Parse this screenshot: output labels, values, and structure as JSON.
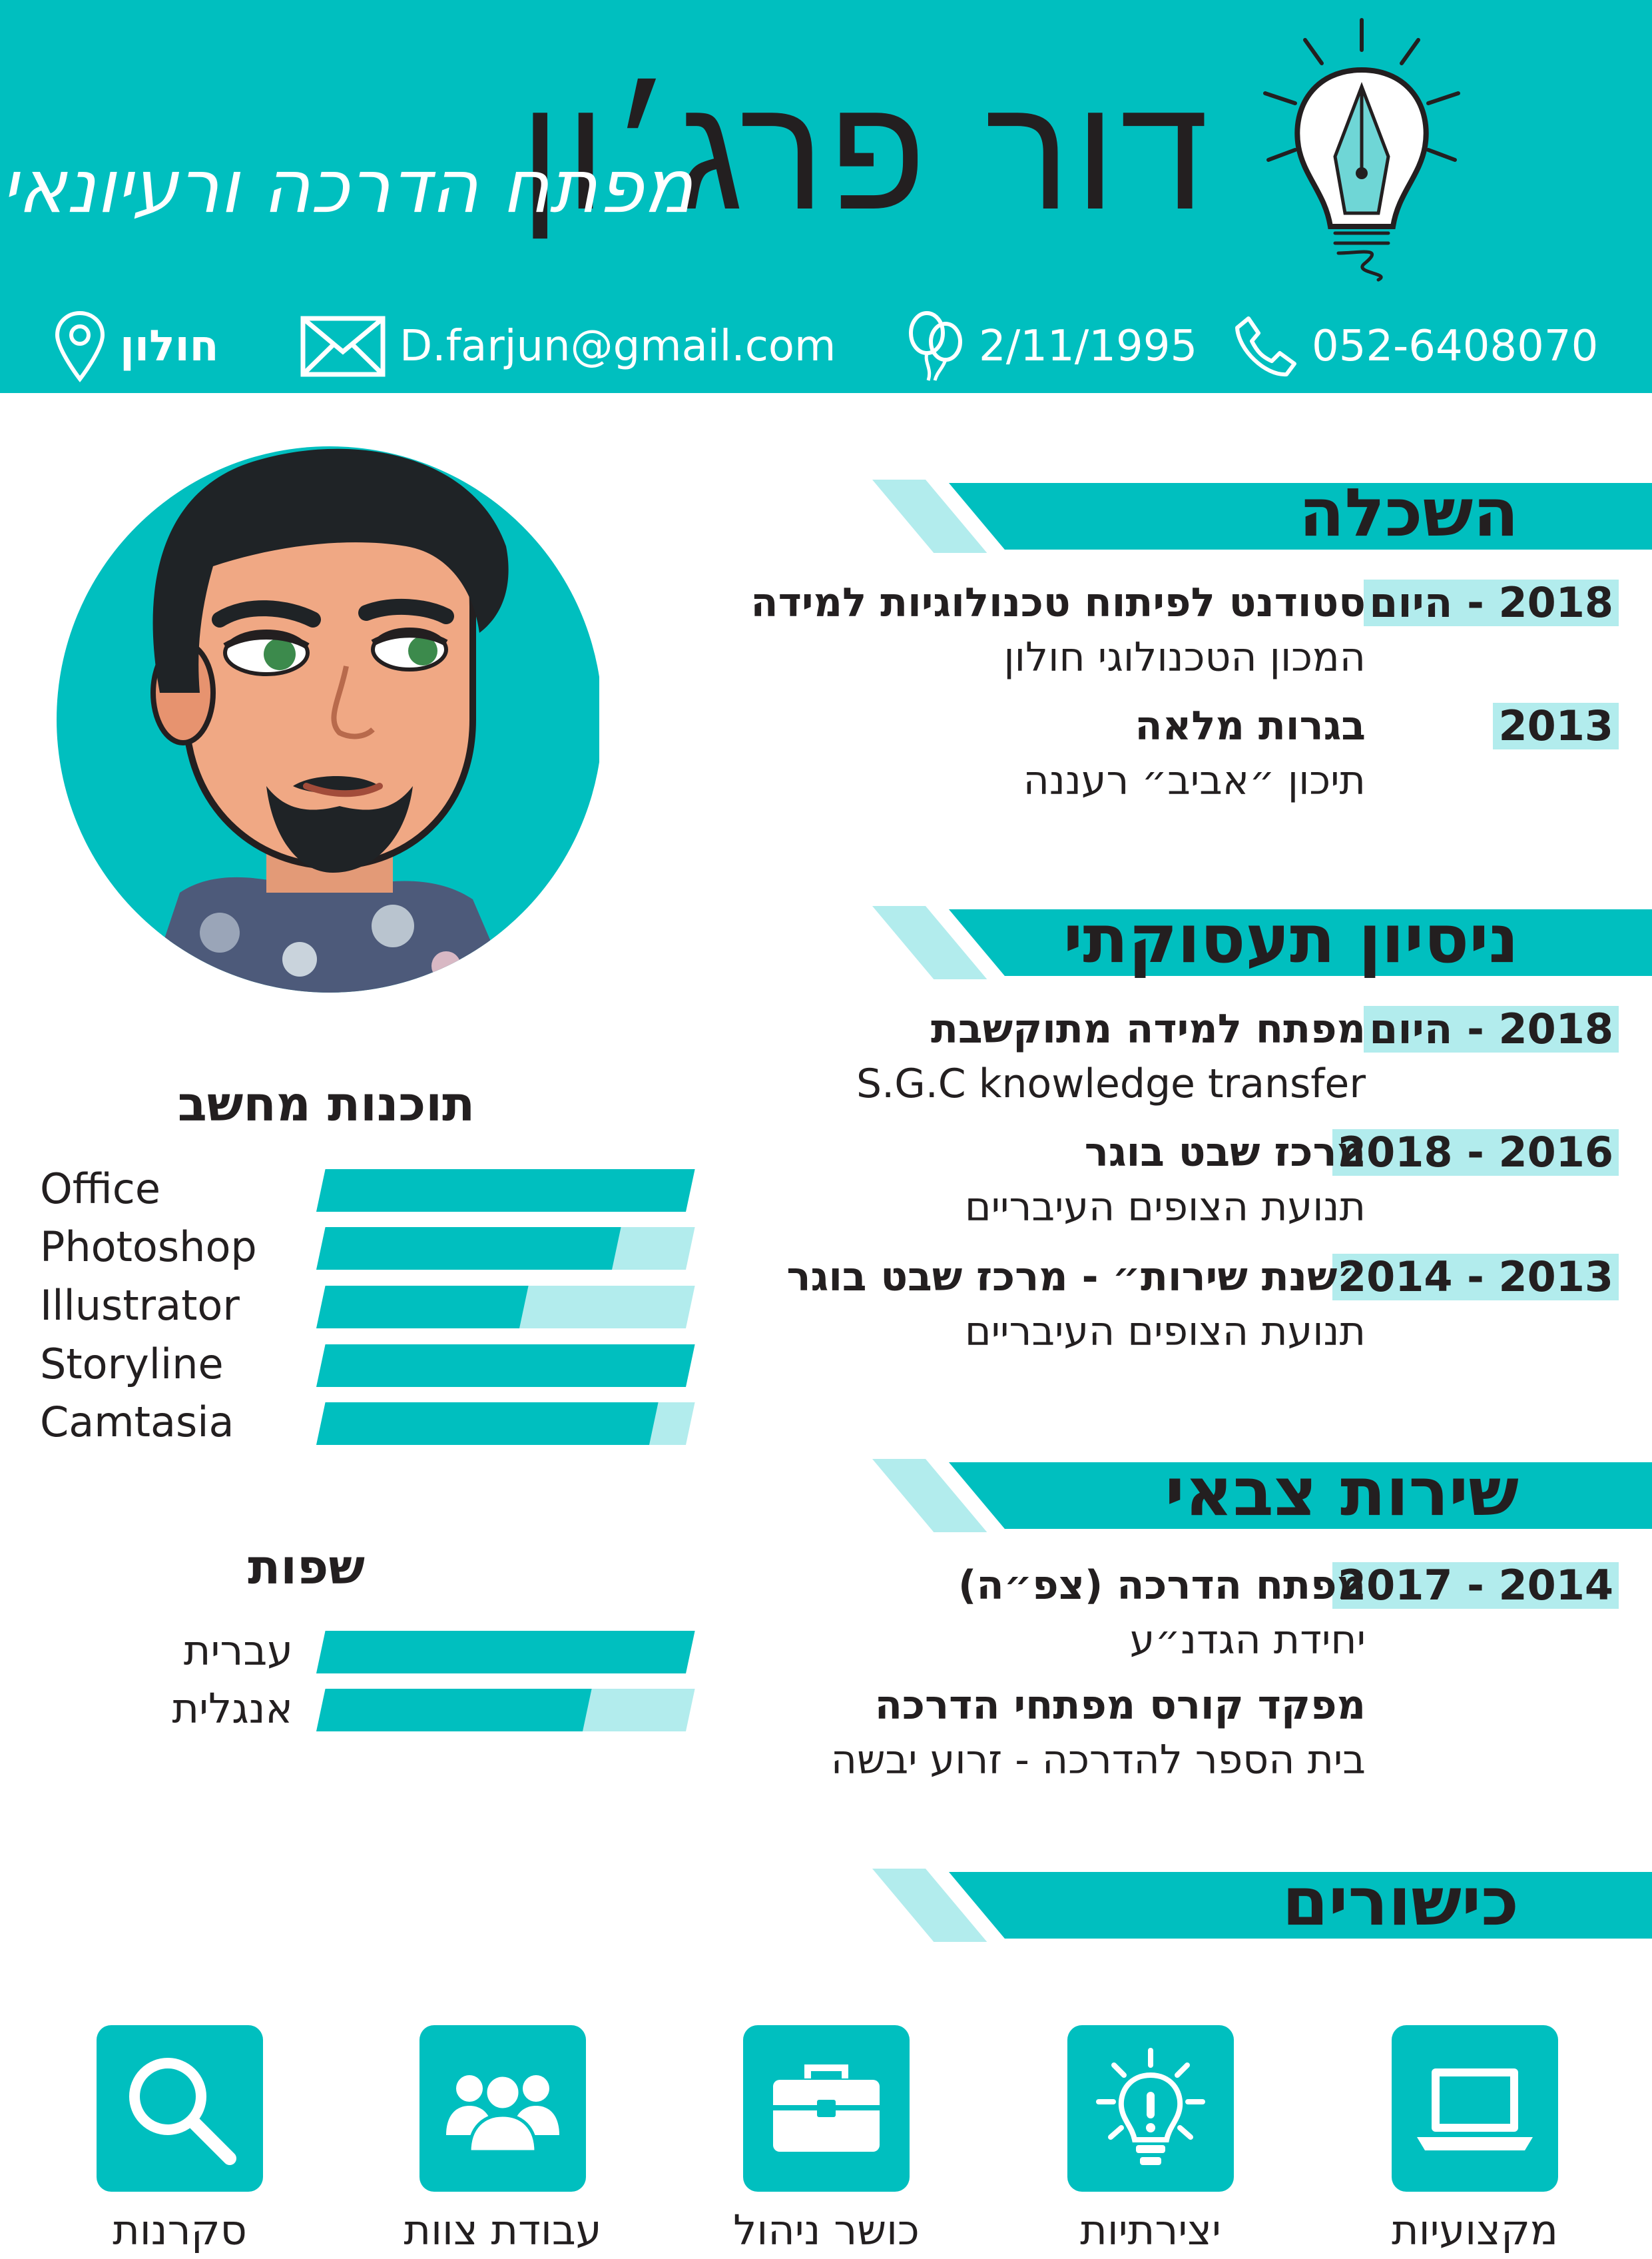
{
  "header": {
    "name": "דור פרג׳ון",
    "subtitle": "מפתח הדרכה ורעיונאי",
    "contacts": {
      "phone": "052-6408070",
      "birthdate": "2/11/1995",
      "email": "D.farjun@gmail.com",
      "city": "חולון"
    }
  },
  "skills": {
    "title": "תוכנות מחשב",
    "items": [
      {
        "name": "Office",
        "level": 1.0
      },
      {
        "name": "Photoshop",
        "level": 0.8
      },
      {
        "name": "Illustrator",
        "level": 0.55
      },
      {
        "name": "Storyline",
        "level": 1.0
      },
      {
        "name": "Camtasia",
        "level": 0.9
      }
    ]
  },
  "languages": {
    "title": "שפות",
    "items": [
      {
        "name": "עברית",
        "level": 1.0
      },
      {
        "name": "אנגלית",
        "level": 0.72
      }
    ]
  },
  "education": {
    "title": "השכלה",
    "entries": [
      {
        "date": "2018 - היום",
        "role": "סטודנט לפיתוח טכנולוגיות למידה",
        "place": "המכון הטכנולוגי חולון"
      },
      {
        "date": "2013",
        "role": "בגרות מלאה",
        "place": "תיכון ״אביב״ רעננה"
      }
    ]
  },
  "experience": {
    "title": "ניסיון תעסוקתי",
    "entries": [
      {
        "date": "2018 - היום",
        "role": "מפתח למידה מתוקשבת",
        "place": "S.G.C knowledge transfer"
      },
      {
        "date": "2016 - 2018",
        "role": "מרכז שבט בוגר",
        "place": "תנועת הצופים העיבריים"
      },
      {
        "date": "2013 - 2014",
        "role": "״שנת שירות״ - מרכז שבט בוגר",
        "place": "תנועת הצופים העיבריים"
      }
    ]
  },
  "military": {
    "title": "שירות צבאי",
    "entries": [
      {
        "date": "2014 - 2017",
        "role": "מפתח הדרכה (צפ״ה)",
        "place": "יחידת הגדנ״ע"
      },
      {
        "date": "",
        "role": "מפקד קורס מפתחי הדרכה",
        "place": "בית הספר להדרכה - זרוע יבשה"
      }
    ]
  },
  "strengths": {
    "title": "כישורים",
    "items": [
      {
        "label": "מקצועיות",
        "icon": "laptop-icon"
      },
      {
        "label": "יצירתיות",
        "icon": "lightbulb-icon"
      },
      {
        "label": "כושר ניהול",
        "icon": "briefcase-icon"
      },
      {
        "label": "עבודת צוות",
        "icon": "team-icon"
      },
      {
        "label": "סקרנות",
        "icon": "magnifier-icon"
      }
    ]
  },
  "colors": {
    "accent": "#00bfbf",
    "accent_light": "#b2eced",
    "text": "#231f20",
    "header_text": "#ffffff"
  }
}
